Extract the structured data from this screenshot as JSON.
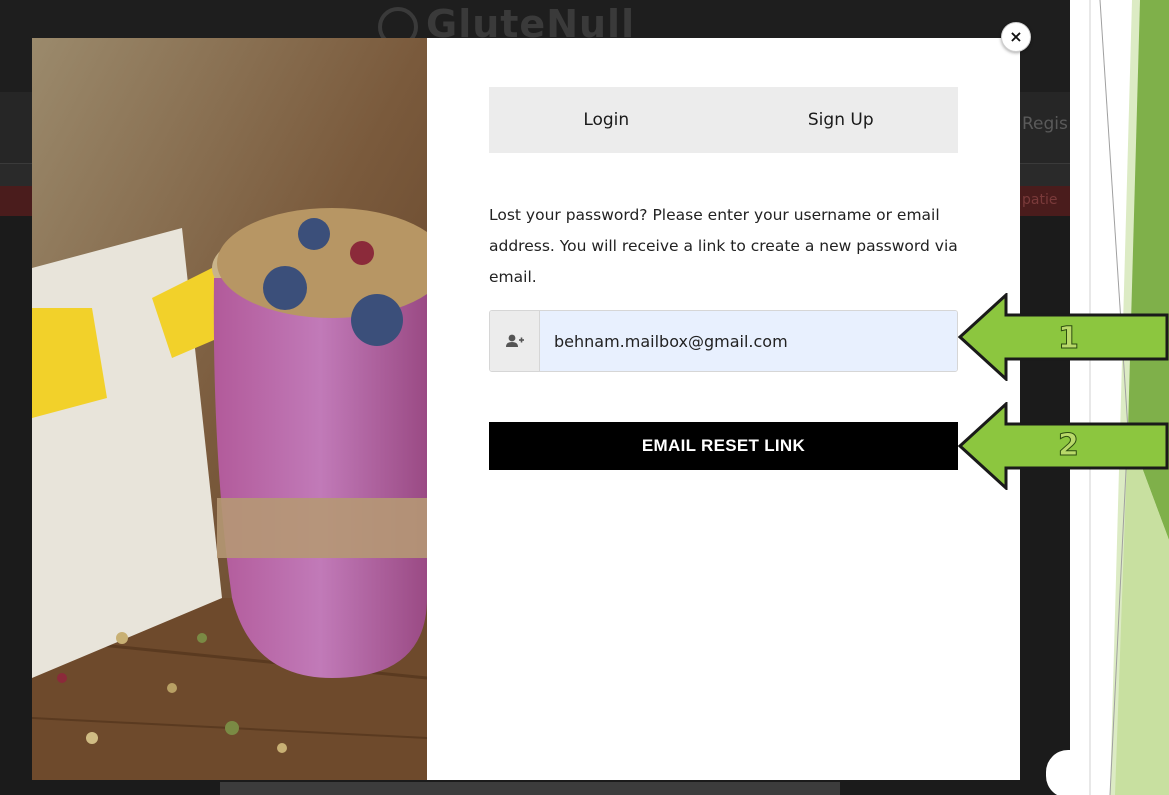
{
  "site": {
    "logo_text": "GluteNull",
    "nav_register": "Regis",
    "promo_fragment": "patie"
  },
  "modal": {
    "close_label": "×",
    "tabs": [
      {
        "label": "Login"
      },
      {
        "label": "Sign Up"
      }
    ],
    "lost_password_text": "Lost your password? Please enter your username or email address. You will receive a link to create a new password via email.",
    "email_field": {
      "value": "behnam.mailbox@gmail.com",
      "icon": "user-plus-icon"
    },
    "reset_button_label": "EMAIL RESET LINK"
  },
  "annotations": [
    {
      "number": "1"
    },
    {
      "number": "2"
    }
  ],
  "colors": {
    "arrow_fill": "#8cc63f",
    "arrow_stroke": "#1a1a1a",
    "slide_green": "#6a9a3a",
    "slide_light_green": "#c8e0a0",
    "button_bg": "#000000",
    "tab_bg": "#ececec",
    "input_bg": "#e8f0fe"
  }
}
